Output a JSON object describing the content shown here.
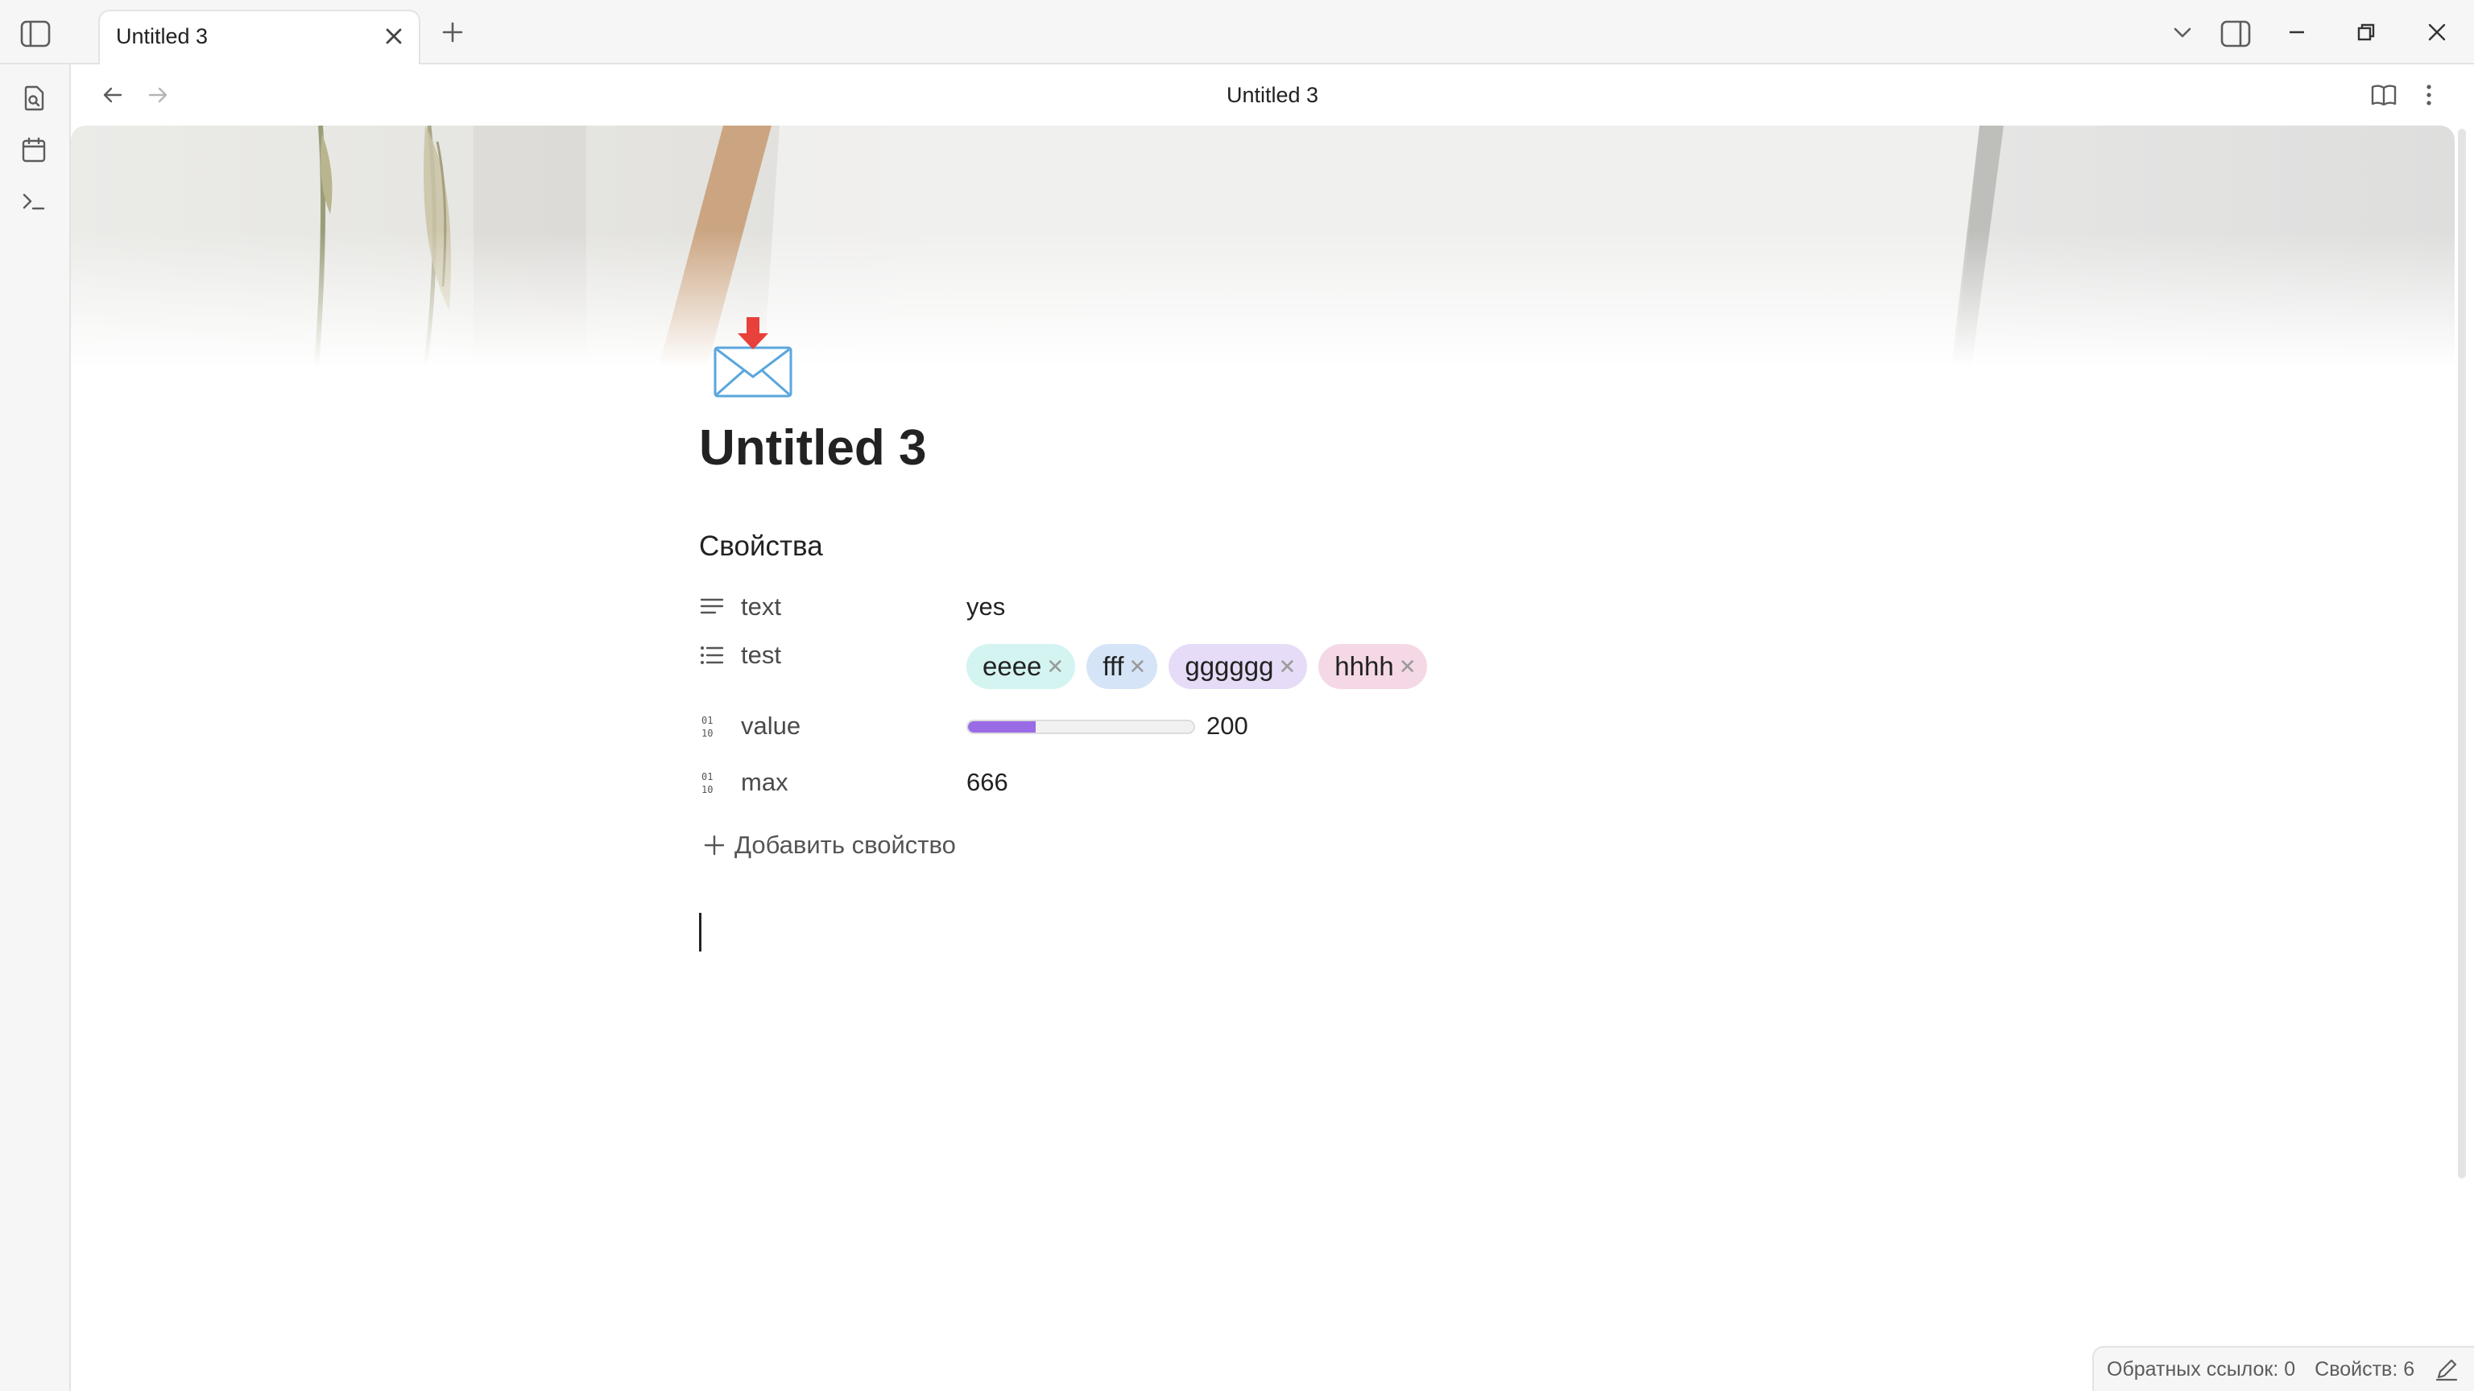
{
  "tab": {
    "title": "Untitled 3"
  },
  "view": {
    "title": "Untitled 3"
  },
  "note": {
    "title": "Untitled 3",
    "icon": "envelope-with-arrow-icon"
  },
  "properties": {
    "heading": "Свойства",
    "text": {
      "key": "text",
      "value": "yes",
      "icon": "text-lines-icon"
    },
    "test": {
      "key": "test",
      "icon": "list-icon",
      "items": [
        {
          "label": "eeee",
          "color": "#d4f4f1"
        },
        {
          "label": "fff",
          "color": "#d5e4f7"
        },
        {
          "label": "gggggg",
          "color": "#e6dcf7"
        },
        {
          "label": "hhhh",
          "color": "#f5d8e5"
        }
      ]
    },
    "value": {
      "key": "value",
      "value": "200",
      "icon": "number-icon",
      "progress_fraction": 0.3,
      "bar_color": "#9a6be6"
    },
    "max": {
      "key": "max",
      "value": "666",
      "icon": "number-icon"
    },
    "add_label": "Добавить свойство"
  },
  "status_bar": {
    "backlinks": "Обратных ссылок: 0",
    "properties_count": "Свойств: 6"
  }
}
